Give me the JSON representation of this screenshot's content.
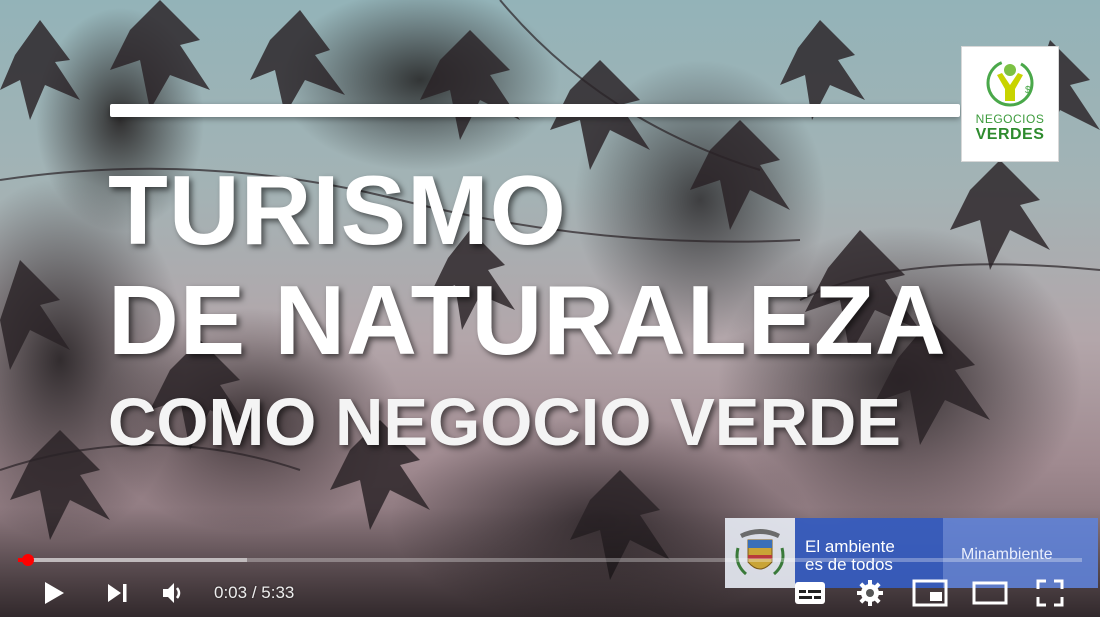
{
  "video": {
    "title_line1": "TURISMO",
    "title_line2": "DE NATURALEZA",
    "title_line3": "COMO NEGOCIO VERDE"
  },
  "logo": {
    "line1": "NEGOCIOS",
    "line2": "VERDES",
    "icon": "negocios-verdes-logo"
  },
  "banner": {
    "slogan_line1": "El ambiente",
    "slogan_line2": "es de todos",
    "ministry": "Minambiente",
    "icon": "coat-of-arms"
  },
  "player": {
    "current_time": "0:03",
    "separator": " / ",
    "duration": "5:33",
    "progress_fraction": 0.009,
    "buffered_fraction": 0.215,
    "accent_color": "#ff0000",
    "controls": {
      "play": "play-icon",
      "next": "next-icon",
      "volume": "volume-icon",
      "subtitles": "subtitles-icon",
      "settings": "gear-icon",
      "miniplayer": "miniplayer-icon",
      "theater": "theater-mode-icon",
      "fullscreen": "fullscreen-icon"
    }
  }
}
